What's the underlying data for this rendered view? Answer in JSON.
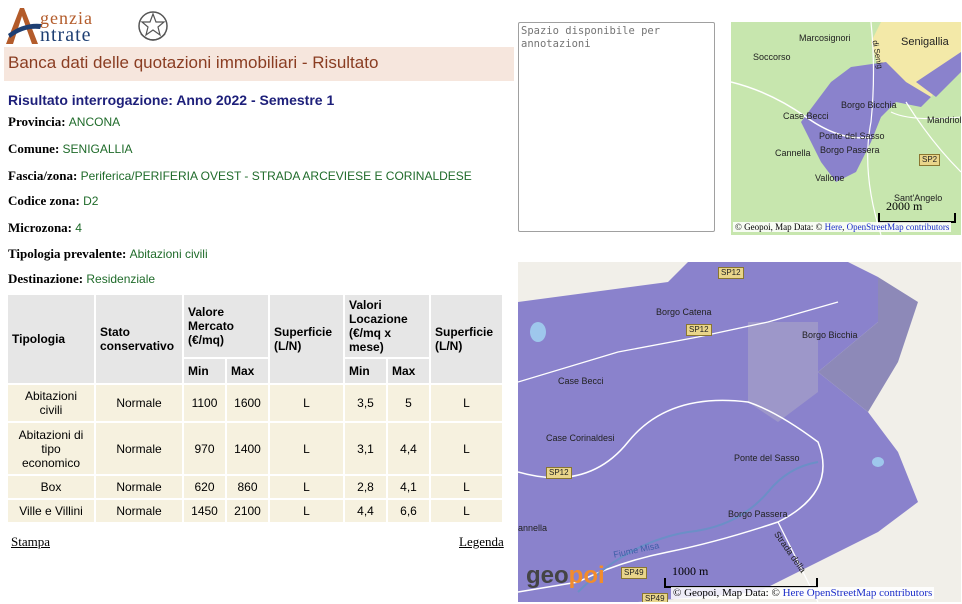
{
  "logo": {
    "line1": "genzia",
    "line2": "ntrate"
  },
  "page_title": "Banca dati delle quotazioni immobiliari - Risultato",
  "result_heading": "Risultato interrogazione: Anno 2022 - Semestre 1",
  "fields": [
    {
      "label": "Provincia:",
      "value": "ANCONA"
    },
    {
      "label": "Comune:",
      "value": "SENIGALLIA"
    },
    {
      "label": "Fascia/zona:",
      "value": "Periferica/PERIFERIA OVEST - STRADA ARCEVIESE E CORINALDESE"
    },
    {
      "label": "Codice zona:",
      "value": "D2"
    },
    {
      "label": "Microzona:",
      "value": "4"
    },
    {
      "label": "Tipologia prevalente:",
      "value": "Abitazioni civili"
    },
    {
      "label": "Destinazione:",
      "value": "Residenziale"
    }
  ],
  "table": {
    "headers": {
      "tipologia": "Tipologia",
      "stato": "Stato conservativo",
      "valore_mercato": "Valore Mercato (€/mq)",
      "superficie1": "Superficie (L/N)",
      "valori_locazione": "Valori Locazione (€/mq x mese)",
      "superficie2": "Superficie (L/N)",
      "min": "Min",
      "max": "Max"
    },
    "rows": [
      {
        "tipologia": "Abitazioni civili",
        "stato": "Normale",
        "vm_min": "1100",
        "vm_max": "1600",
        "sup1": "L",
        "loc_min": "3,5",
        "loc_max": "5",
        "sup2": "L"
      },
      {
        "tipologia": "Abitazioni di tipo economico",
        "stato": "Normale",
        "vm_min": "970",
        "vm_max": "1400",
        "sup1": "L",
        "loc_min": "3,1",
        "loc_max": "4,4",
        "sup2": "L"
      },
      {
        "tipologia": "Box",
        "stato": "Normale",
        "vm_min": "620",
        "vm_max": "860",
        "sup1": "L",
        "loc_min": "2,8",
        "loc_max": "4,1",
        "sup2": "L"
      },
      {
        "tipologia": "Ville e Villini",
        "stato": "Normale",
        "vm_min": "1450",
        "vm_max": "2100",
        "sup1": "L",
        "loc_min": "4,4",
        "loc_max": "6,6",
        "sup2": "L"
      }
    ]
  },
  "links": {
    "stampa": "Stampa",
    "legenda": "Legenda"
  },
  "notes": {
    "placeholder": "Spazio disponibile per annotazioni"
  },
  "map_small": {
    "labels": [
      "Senigallia",
      "Marcosignori",
      "Soccorso",
      "Borgo Bicchia",
      "Case Becci",
      "Ponte del Sasso",
      "Cannella",
      "Borgo Passera",
      "Vallone",
      "Mandriol",
      "Sant'Angelo",
      "di Senig"
    ],
    "road_badge": "SP2",
    "scale": "2000 m",
    "attribution_prefix": "© Geopoi, Map Data: © ",
    "attribution_here": "Here",
    "attribution_sep": ", ",
    "attribution_osm": "OpenStreetMap contributors"
  },
  "map_large": {
    "labels": [
      "Borgo Catena",
      "Borgo Bicchia",
      "Case Becci",
      "Case Corinaldesi",
      "Ponte del Sasso",
      "Borgo Passera",
      "annella",
      "Fiume Misa",
      "Strada della"
    ],
    "road_badges": [
      "SP12",
      "SP12",
      "SP12",
      "SP49",
      "SP49"
    ],
    "brand": "geopoi",
    "scale": "1000 m",
    "attribution_prefix": "© Geopoi, Map Data: © ",
    "attribution_here": "Here",
    "attribution_sep": " ",
    "attribution_osm": "OpenStreetMap contributors"
  },
  "colors": {
    "title_bg": "#f6e6dd",
    "title_text": "#8a3d22",
    "heading": "#1d1f7a",
    "value_text": "#1f6b2a",
    "zone_purple": "#8a82cc"
  }
}
